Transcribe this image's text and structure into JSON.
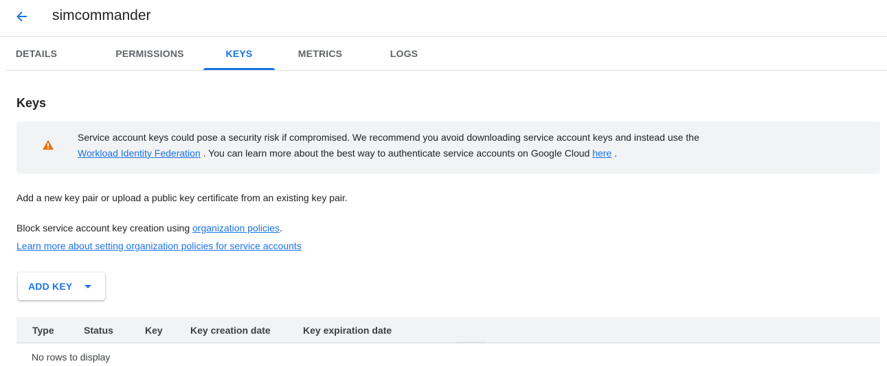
{
  "header": {
    "title": "simcommander"
  },
  "tabs": [
    {
      "label": "DETAILS"
    },
    {
      "label": "PERMISSIONS"
    },
    {
      "label": "KEYS",
      "active": true
    },
    {
      "label": "METRICS"
    },
    {
      "label": "LOGS"
    }
  ],
  "keys": {
    "title": "Keys",
    "warning": {
      "text_1": "Service account keys could pose a security risk if compromised. We recommend you avoid downloading service account keys and instead use the",
      "link_1": "Workload Identity Federation",
      "text_2": ". You can learn more about the best way to authenticate service accounts on Google Cloud",
      "link_2": "here",
      "text_3": "."
    },
    "description": "Add a new key pair or upload a public key certificate from an existing key pair.",
    "block_text": "Block service account key creation using",
    "block_link": "organization policies",
    "block_end": ".",
    "learn_more_link": "Learn more about setting organization policies for service accounts",
    "add_key_label": "ADD KEY",
    "table": {
      "columns": [
        "Type",
        "Status",
        "Key",
        "Key creation date",
        "Key expiration date"
      ],
      "empty_message": "No rows to display"
    }
  },
  "colors": {
    "accent": "#1a73e8",
    "warning": "#e8710a",
    "panel": "#f1f3f4"
  },
  "icons": {
    "back": "arrow-left-icon",
    "warning": "warning-triangle-icon",
    "dropdown": "caret-down-icon"
  }
}
